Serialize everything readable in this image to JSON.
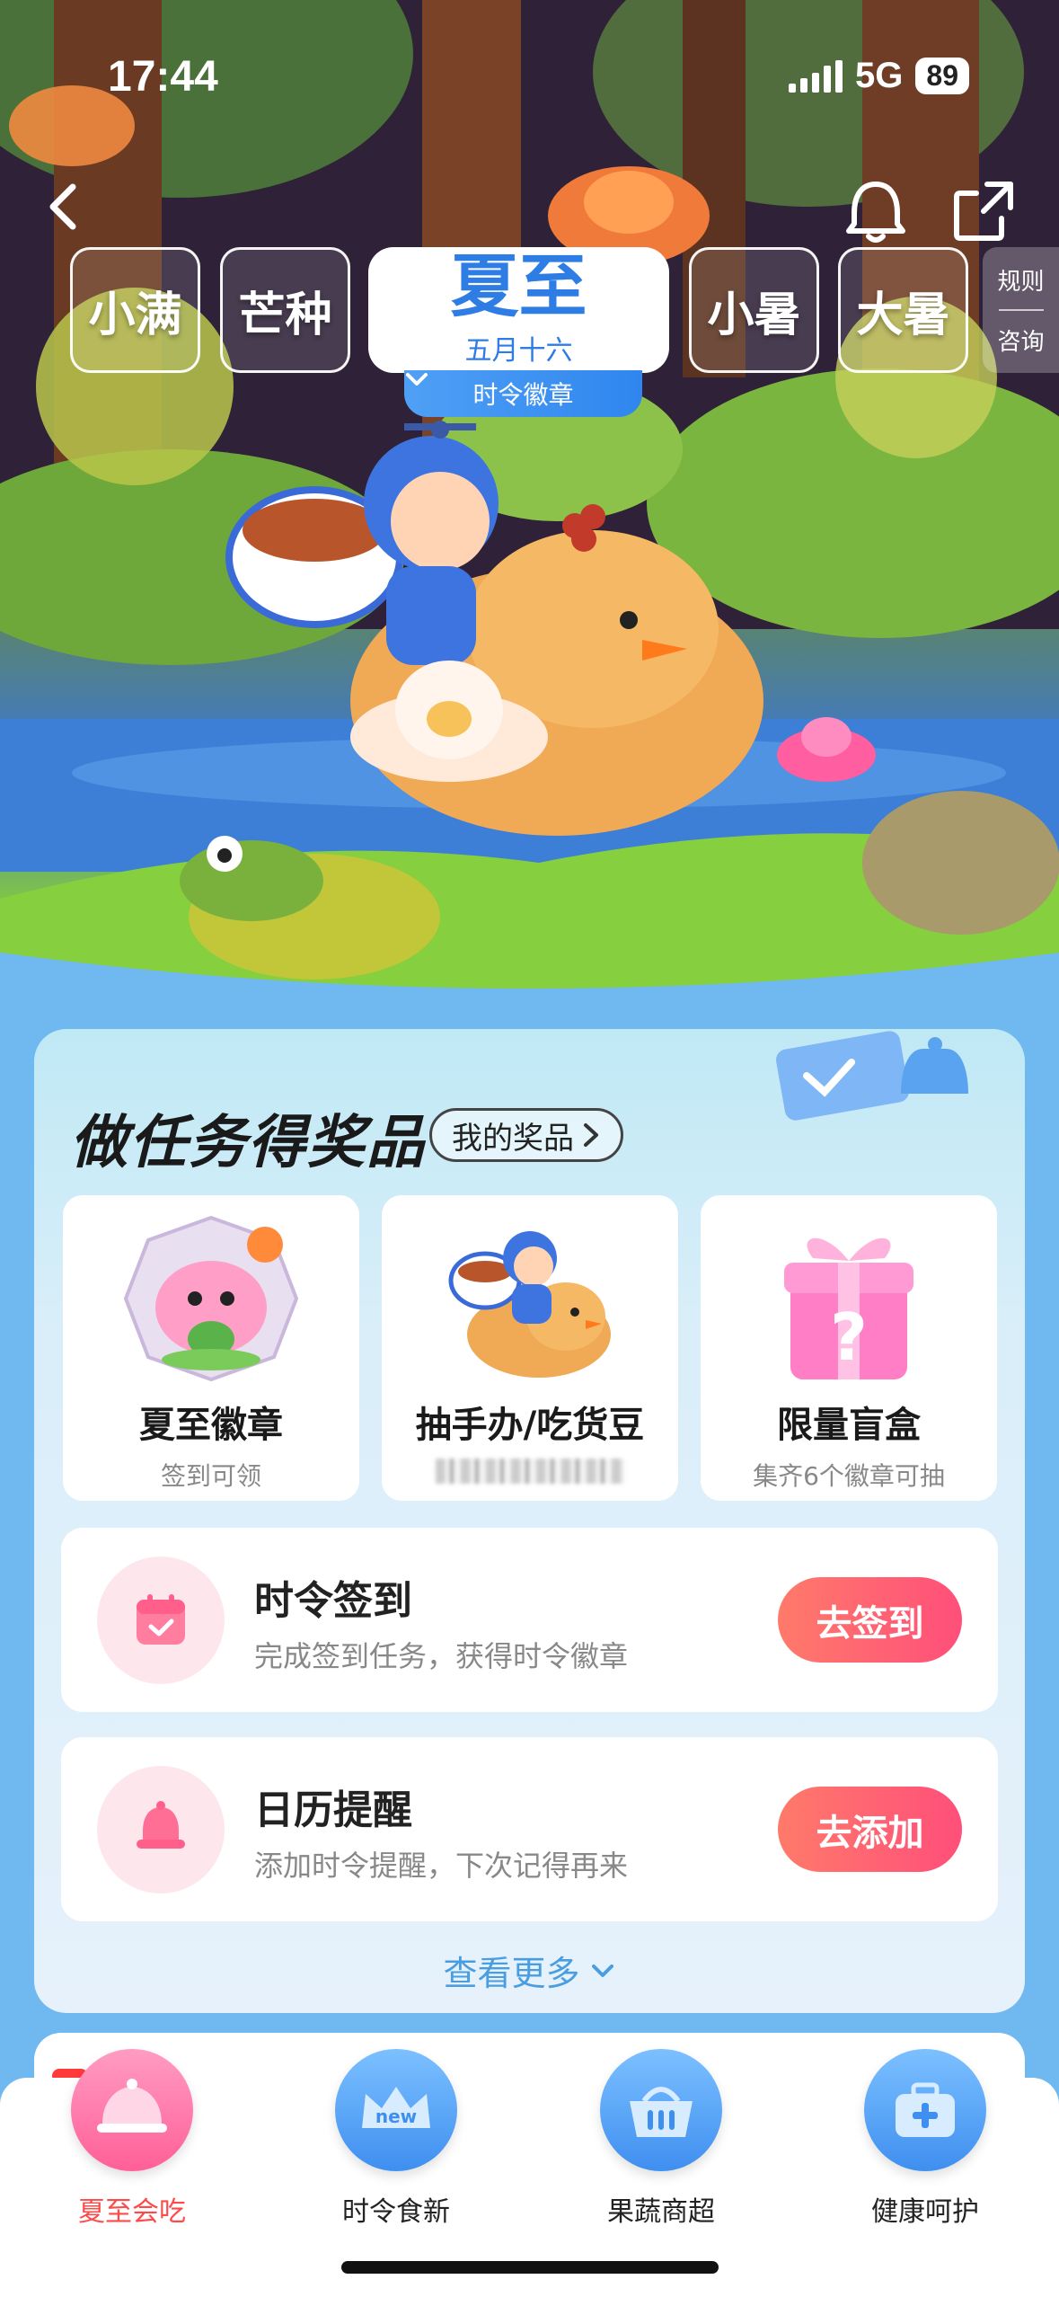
{
  "status_bar": {
    "time": "17:44",
    "network": "5G",
    "battery": "89"
  },
  "terms": {
    "left": [
      "小满",
      "芒种"
    ],
    "active": {
      "name": "夏至",
      "date": "五月十六",
      "badge_label": "时令徽章"
    },
    "right": [
      "小暑",
      "大暑"
    ],
    "side": [
      "规则",
      "咨询"
    ]
  },
  "panel": {
    "title": "做任务得奖品",
    "my_prizes": "我的奖品",
    "prizes": [
      {
        "name": "夏至徽章",
        "desc": "签到可领"
      },
      {
        "name": "抽手办/吃货豆",
        "desc": ""
      },
      {
        "name": "限量盲盒",
        "desc": "集齐6个徽章可抽"
      }
    ],
    "tasks": [
      {
        "title": "时令签到",
        "sub": "完成签到任务，获得时令徽章",
        "button": "去签到",
        "icon": "calendar-icon"
      },
      {
        "title": "日历提醒",
        "sub": "添加时令提醒，下次记得再来",
        "button": "去添加",
        "icon": "bell-icon"
      }
    ],
    "see_more": "查看更多"
  },
  "bottom_nav": [
    {
      "label": "夏至会吃",
      "icon": "cloche-icon",
      "active": true
    },
    {
      "label": "时令食新",
      "icon": "crown-new-icon",
      "active": false
    },
    {
      "label": "果蔬商超",
      "icon": "basket-icon",
      "active": false
    },
    {
      "label": "健康呵护",
      "icon": "medkit-icon",
      "active": false
    }
  ],
  "colors": {
    "accent_blue": "#2d7de5",
    "button_gradient_start": "#ff7a6a",
    "button_gradient_end": "#ff4f7a",
    "nav_active": "#ff4a4a",
    "page_bg": "#6fb8f0"
  }
}
